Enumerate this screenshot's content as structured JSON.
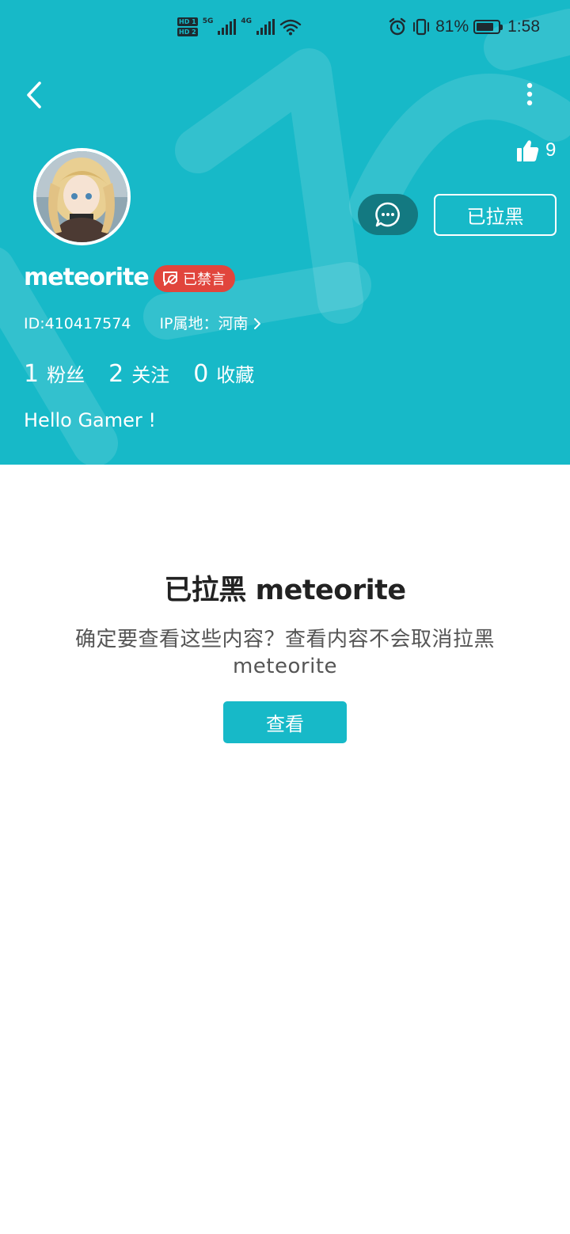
{
  "status_bar": {
    "hd1": "HD 1",
    "hd2": "HD 2",
    "net1": "5G",
    "net2": "4G",
    "battery_pct": "81%",
    "battery_level": 0.81,
    "time": "1:58",
    "icons": [
      "signal-icon",
      "wifi-icon",
      "alarm-icon",
      "vibrate-icon",
      "battery-icon"
    ]
  },
  "toolbar": {
    "back_icon": "back-arrow-icon",
    "more_icon": "more-vertical-icon"
  },
  "profile": {
    "likes_icon": "thumbs-up-icon",
    "likes": "9",
    "chat_icon": "chat-bubble-icon",
    "blocked_label": "已拉黑",
    "username": "meteorite",
    "mute_badge": "已禁言",
    "id": "ID:410417574",
    "ip_location": "IP属地：河南",
    "stats": [
      {
        "count": "1",
        "label": "粉丝"
      },
      {
        "count": "2",
        "label": "关注"
      },
      {
        "count": "0",
        "label": "收藏"
      }
    ],
    "bio": "Hello Gamer !"
  },
  "blocked_notice": {
    "title": "已拉黑 meteorite",
    "description": "确定要查看这些内容？查看内容不会取消拉黑 meteorite",
    "view_button": "查看"
  },
  "colors": {
    "accent": "#17b9c8",
    "chat_button": "#137981",
    "mute_badge": "#e1453c"
  }
}
